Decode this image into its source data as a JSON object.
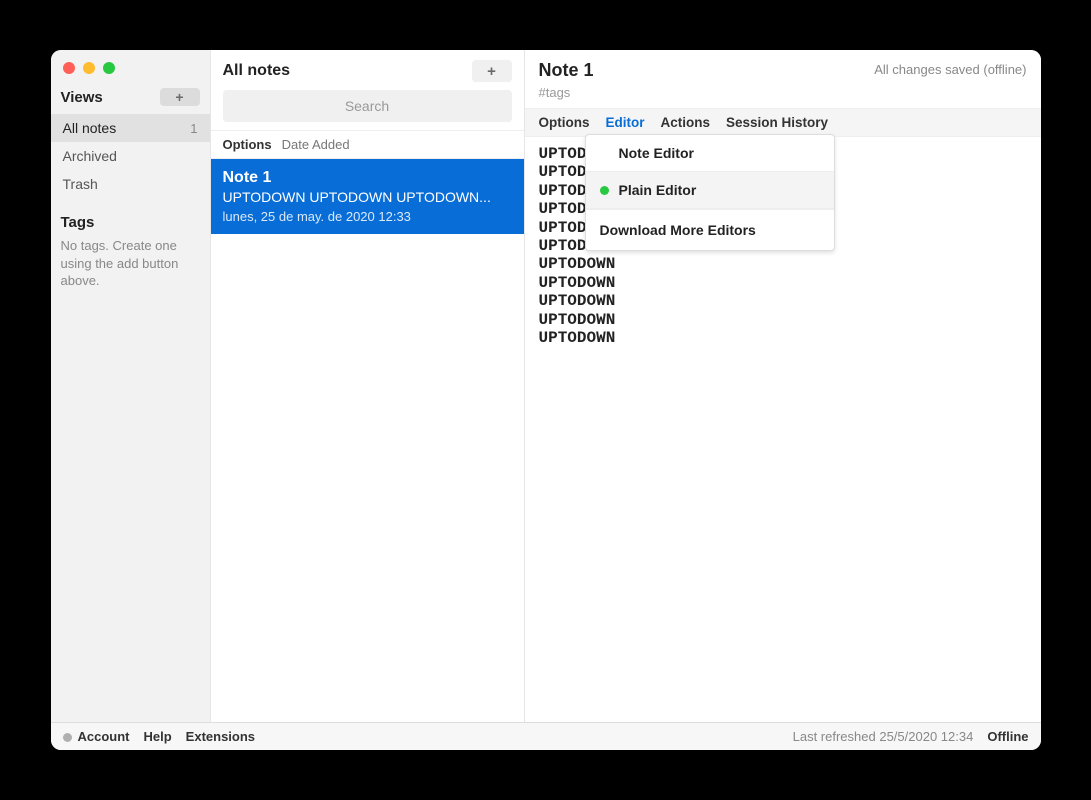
{
  "sidebar": {
    "views_label": "Views",
    "items": [
      {
        "label": "All notes",
        "count": "1",
        "active": true
      },
      {
        "label": "Archived",
        "count": "",
        "active": false
      },
      {
        "label": "Trash",
        "count": "",
        "active": false
      }
    ],
    "tags_label": "Tags",
    "tags_empty": "No tags. Create one using the add button above."
  },
  "notes_column": {
    "title": "All notes",
    "search_placeholder": "Search",
    "options_label": "Options",
    "sort_label": "Date Added",
    "notes": [
      {
        "title": "Note 1",
        "preview": "UPTODOWN UPTODOWN UPTODOWN...",
        "date": "lunes, 25 de may. de 2020 12:33",
        "selected": true
      }
    ]
  },
  "editor": {
    "title": "Note 1",
    "tags_placeholder": "#tags",
    "save_status": "All changes saved (offline)",
    "tabs": {
      "options": "Options",
      "editor": "Editor",
      "actions": "Actions",
      "session_history": "Session History"
    },
    "body_lines": [
      "UPTODOWN",
      "UPTODOWN",
      "UPTODOWN",
      "UPTODOWN",
      "UPTODOWN",
      "UPTODOWN",
      "UPTODOWN",
      "UPTODOWN",
      "UPTODOWN",
      "UPTODOWN",
      "UPTODOWN"
    ],
    "dropdown": {
      "note_editor": "Note Editor",
      "plain_editor": "Plain Editor",
      "download_more": "Download More Editors"
    }
  },
  "footer": {
    "account": "Account",
    "help": "Help",
    "extensions": "Extensions",
    "last_refreshed": "Last refreshed 25/5/2020 12:34",
    "offline": "Offline"
  }
}
